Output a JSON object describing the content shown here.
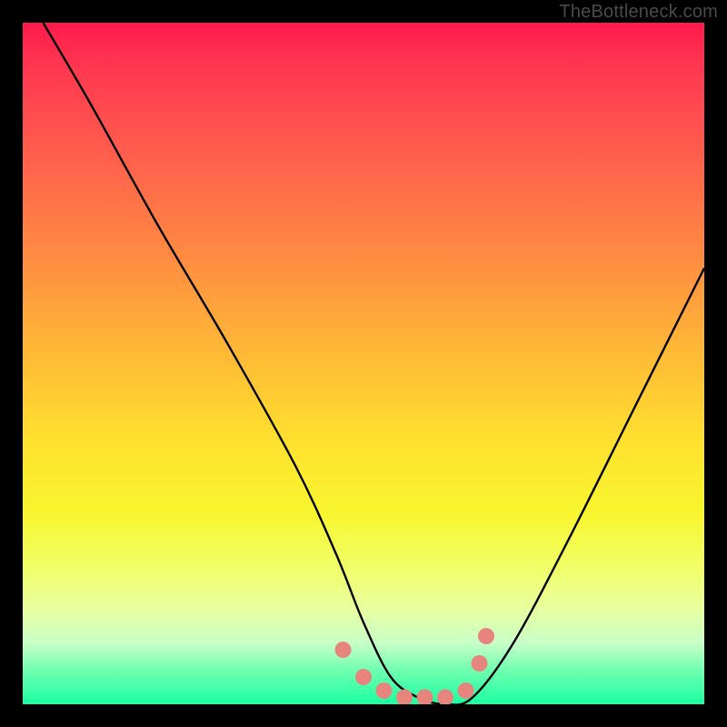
{
  "watermark": "TheBottleneck.com",
  "chart_data": {
    "type": "line",
    "title": "",
    "xlabel": "",
    "ylabel": "",
    "xlim": [
      0,
      100
    ],
    "ylim": [
      0,
      100
    ],
    "series": [
      {
        "name": "bottleneck-curve",
        "x": [
          3,
          10,
          20,
          30,
          40,
          46,
          50,
          54,
          58,
          62,
          66,
          72,
          80,
          90,
          100
        ],
        "y": [
          100,
          88,
          70,
          53,
          35,
          22,
          12,
          4,
          1,
          0,
          1,
          9,
          24,
          44,
          64
        ]
      }
    ],
    "markers": {
      "name": "highlight-points",
      "color": "#e8847e",
      "x": [
        47,
        50,
        53,
        56,
        59,
        62,
        65,
        67,
        68
      ],
      "y": [
        8,
        4,
        2,
        1,
        1,
        1,
        2,
        6,
        10
      ]
    },
    "background_gradient": {
      "stops": [
        {
          "pos": 0,
          "color": "#ff1a4d"
        },
        {
          "pos": 50,
          "color": "#ffd030"
        },
        {
          "pos": 80,
          "color": "#f1ff68"
        },
        {
          "pos": 100,
          "color": "#1affa0"
        }
      ]
    }
  }
}
